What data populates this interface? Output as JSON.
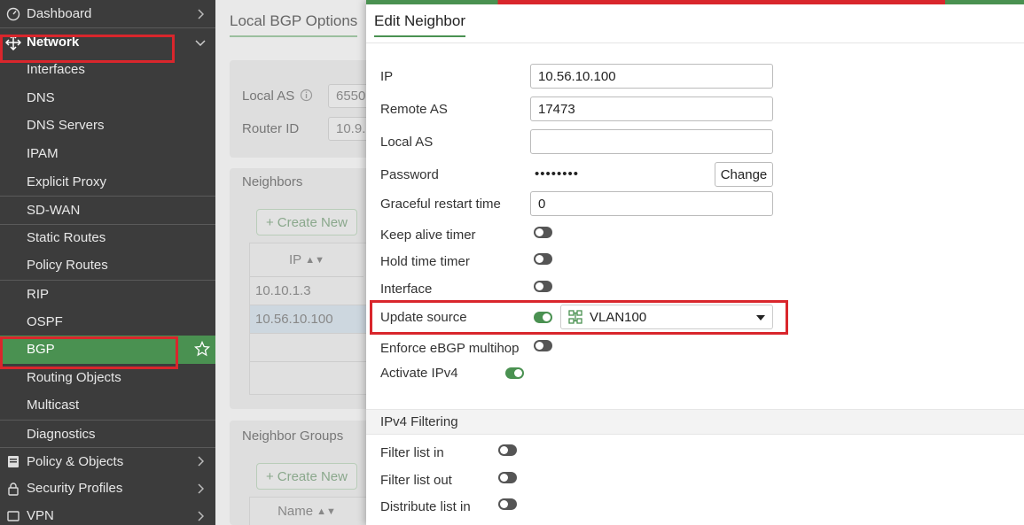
{
  "sidebar": {
    "dashboard": "Dashboard",
    "network": "Network",
    "subitems": [
      "Interfaces",
      "DNS",
      "DNS Servers",
      "IPAM",
      "Explicit Proxy",
      "SD-WAN",
      "Static Routes",
      "Policy Routes",
      "RIP",
      "OSPF",
      "BGP",
      "Routing Objects",
      "Multicast",
      "Diagnostics"
    ],
    "policy_objects": "Policy & Objects",
    "security_profiles": "Security Profiles",
    "vpn": "VPN"
  },
  "background": {
    "tab": "Local BGP Options",
    "local_as_label": "Local AS",
    "local_as_value": "6550",
    "router_id_label": "Router ID",
    "router_id_value": "10.9.",
    "neighbors_label": "Neighbors",
    "create_new": "Create New",
    "ip_col": "IP",
    "rows": [
      "10.10.1.3",
      "10.56.10.100"
    ],
    "neighbor_groups_label": "Neighbor Groups",
    "name_col": "Name"
  },
  "dialog": {
    "title": "Edit Neighbor",
    "ip_label": "IP",
    "ip_value": "10.56.10.100",
    "remote_as_label": "Remote AS",
    "remote_as_value": "17473",
    "local_as_label": "Local AS",
    "local_as_value": "",
    "password_label": "Password",
    "password_mask": "••••••••",
    "change_label": "Change",
    "graceful_label": "Graceful restart time",
    "graceful_value": "0",
    "keepalive_label": "Keep alive timer",
    "keepalive_on": false,
    "holdtime_label": "Hold time timer",
    "holdtime_on": false,
    "interface_label": "Interface",
    "interface_on": false,
    "update_source_label": "Update source",
    "update_source_on": true,
    "update_source_value": "VLAN100",
    "ebgp_label": "Enforce eBGP multihop",
    "ebgp_on": false,
    "ipv4_label": "Activate IPv4",
    "ipv4_on": true,
    "ipv4_filtering": "IPv4 Filtering",
    "filter_in_label": "Filter list in",
    "filter_out_label": "Filter list out",
    "distribute_in_label": "Distribute list in"
  },
  "colors": {
    "accent": "#4a9151",
    "highlight": "#d9262c",
    "sidebar": "#3c3c3c"
  }
}
